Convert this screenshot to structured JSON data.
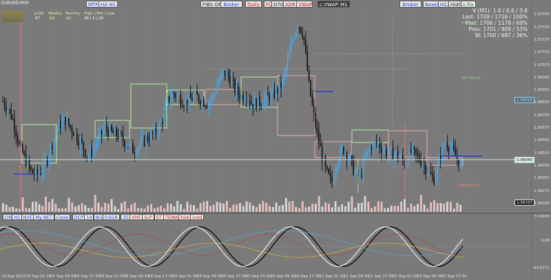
{
  "symbol_label": "EURUSD,M30",
  "info_table": {
    "headers": [
      "p.DR",
      "Weekly",
      "Monthly",
      "High | Mid | Low"
    ],
    "row1": [
      "97",
      "69",
      "65",
      "38 | 6 | 26"
    ]
  },
  "top_buttons": {
    "mtf": "MTF",
    "ha": "HA H1",
    "fibs": "FIBS OFF",
    "broker": "Broker",
    "daily": "Daily",
    "fc": "FC",
    "g70": "G70",
    "adr": "ADR",
    "vwap": "VWAP",
    "cvwap": "c.VWAP",
    "m1": "M1",
    "broker2": "Broker",
    "boxed": "Boxed",
    "h12": "H12",
    "hidg": "HidG",
    "cfix": "c.Fix"
  },
  "stats": [
    "V (M1): 1.6 / 0.6 / 3.6",
    "Last: 1709 / 1716 / 100%",
    "Past: 1706 / 1178 / 69%",
    "Prev: 1701 / 909 / 53%",
    "W: 1700 / 687 / 36%"
  ],
  "wk_hi": "Wk Hi",
  "wk_mid_hi": "Wk Mid Hi",
  "wk_mid_lo": "Wk Mid Lo",
  "price_axis": [
    "1.07395",
    "1.07315",
    "1.07235",
    "1.07155",
    "1.07075",
    "1.06995",
    "1.06915",
    "1.06835",
    "1.06755",
    "1.06675",
    "1.06595",
    "1.06515",
    "1.06435",
    "1.06355",
    "1.06275",
    "1.06195"
  ],
  "price_box_1": "1.06818",
  "price_box_2": "1.06440",
  "price_box_3": "1.06197",
  "indicator_buttons": [
    "ON",
    "H1",
    "NYE",
    "My NET",
    "Close",
    "DCP",
    "14",
    "W1",
    "0.618",
    "35",
    "VHF",
    "SLP",
    "ST",
    "TEMA",
    "SSA",
    "Lmd"
  ],
  "indicator_axis": [
    "73.9930",
    "0.88",
    "-63.9771"
  ],
  "time_axis": [
    "14 Sep 2023",
    "15 Sep 01:30",
    "15 Sep 09:30",
    "15 Sep 17:30",
    "18 Sep 01:30",
    "18 Sep 09:30",
    "18 Sep 17:30",
    "19 Sep 01:30",
    "19 Sep 09:30",
    "19 Sep 17:30",
    "20 Sep 01:30",
    "20 Sep 09:30",
    "20 Sep 17:30",
    "21 Sep 01:30",
    "21 Sep 09:30",
    "21 Sep 17:30",
    "22 Sep 01:30",
    "22 Sep 09:30",
    "22 Sep 17:30"
  ],
  "chart_data": {
    "type": "candlestick",
    "symbol": "EURUSD",
    "timeframe": "M30",
    "ylim": [
      1.0616,
      1.0744
    ],
    "close_path": [
      1.0685,
      1.068,
      1.0671,
      1.0655,
      1.0648,
      1.064,
      1.0638,
      1.0642,
      1.065,
      1.0662,
      1.067,
      1.0673,
      1.0668,
      1.0663,
      1.0657,
      1.065,
      1.0655,
      1.0662,
      1.0668,
      1.0665,
      1.0664,
      1.0661,
      1.0657,
      1.0654,
      1.0657,
      1.066,
      1.0663,
      1.0665,
      1.0672,
      1.0685,
      1.069,
      1.0688,
      1.0684,
      1.0686,
      1.0688,
      1.0686,
      1.0684,
      1.0688,
      1.0697,
      1.0703,
      1.07,
      1.0692,
      1.0688,
      1.0689,
      1.0683,
      1.0684,
      1.0686,
      1.0688,
      1.069,
      1.0694,
      1.0706,
      1.0723,
      1.0735,
      1.0728,
      1.0695,
      1.0672,
      1.0655,
      1.064,
      1.0633,
      1.0648,
      1.0655,
      1.065,
      1.064,
      1.0636,
      1.065,
      1.0657,
      1.0658,
      1.0655,
      1.0651,
      1.0652,
      1.065,
      1.0645,
      1.0653,
      1.065,
      1.0646,
      1.064,
      1.0635,
      1.0648,
      1.066,
      1.0655,
      1.0649,
      1.0644
    ],
    "indicator": {
      "ylim": [
        -63.9771,
        73.993
      ],
      "zero": 0.88
    }
  }
}
